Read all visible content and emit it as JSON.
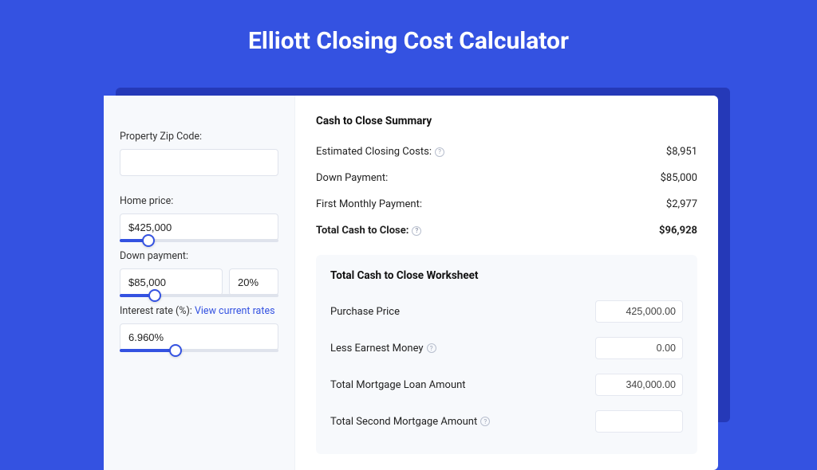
{
  "header": {
    "title": "Elliott Closing Cost Calculator"
  },
  "form": {
    "zip_label": "Property Zip Code:",
    "zip_value": "",
    "home_price_label": "Home price:",
    "home_price_value": "$425,000",
    "home_price_pct": 18,
    "down_payment_label": "Down payment:",
    "down_payment_value": "$85,000",
    "down_payment_pct_value": "20%",
    "down_payment_slider_pct": 22,
    "interest_label_prefix": "Interest rate (%): ",
    "interest_link_text": "View current rates",
    "interest_value": "6.960%",
    "interest_slider_pct": 35
  },
  "summary": {
    "title": "Cash to Close Summary",
    "lines": [
      {
        "label": "Estimated Closing Costs:",
        "help": true,
        "value": "$8,951",
        "bold": false
      },
      {
        "label": "Down Payment:",
        "help": false,
        "value": "$85,000",
        "bold": false
      },
      {
        "label": "First Monthly Payment:",
        "help": false,
        "value": "$2,977",
        "bold": false
      },
      {
        "label": "Total Cash to Close:",
        "help": true,
        "value": "$96,928",
        "bold": true
      }
    ]
  },
  "worksheet": {
    "title": "Total Cash to Close Worksheet",
    "rows": [
      {
        "label": "Purchase Price",
        "help": false,
        "value": "425,000.00"
      },
      {
        "label": "Less Earnest Money",
        "help": true,
        "value": "0.00"
      },
      {
        "label": "Total Mortgage Loan Amount",
        "help": false,
        "value": "340,000.00"
      },
      {
        "label": "Total Second Mortgage Amount",
        "help": true,
        "value": ""
      }
    ]
  }
}
